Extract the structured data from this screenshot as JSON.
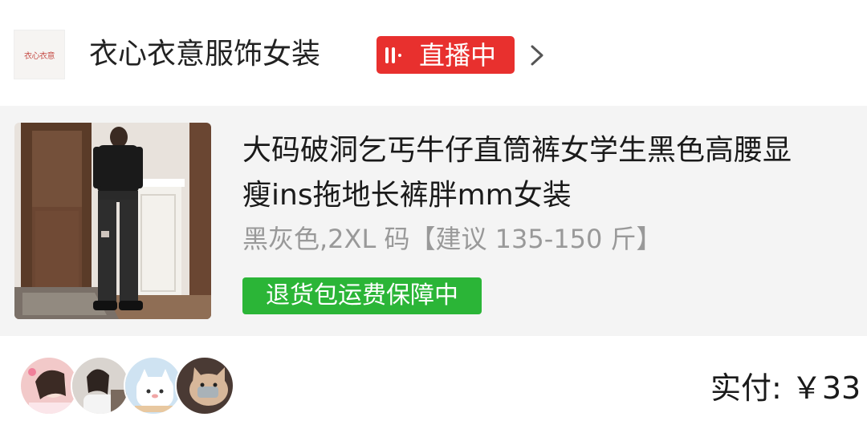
{
  "store": {
    "logo_text": "衣心衣意",
    "name": "衣心衣意服饰女装",
    "live_badge": "直播中",
    "live_icon": "live-bars-icon",
    "chevron_icon": "chevron-right-icon"
  },
  "product": {
    "title_line1": "大码破洞乞丐牛仔直筒裤女学生黑色高腰显",
    "title_line2": "瘦ins拖地长裤胖mm女装",
    "spec": "黑灰色,2XL 码【建议 135-150 斤】",
    "return_badge": "退货包运费保障中"
  },
  "footer": {
    "paid_label": "实付: ￥33"
  },
  "colors": {
    "live_red": "#e8302e",
    "guarantee_green": "#2bb537",
    "card_bg": "#f4f4f4",
    "spec_gray": "#999999"
  }
}
